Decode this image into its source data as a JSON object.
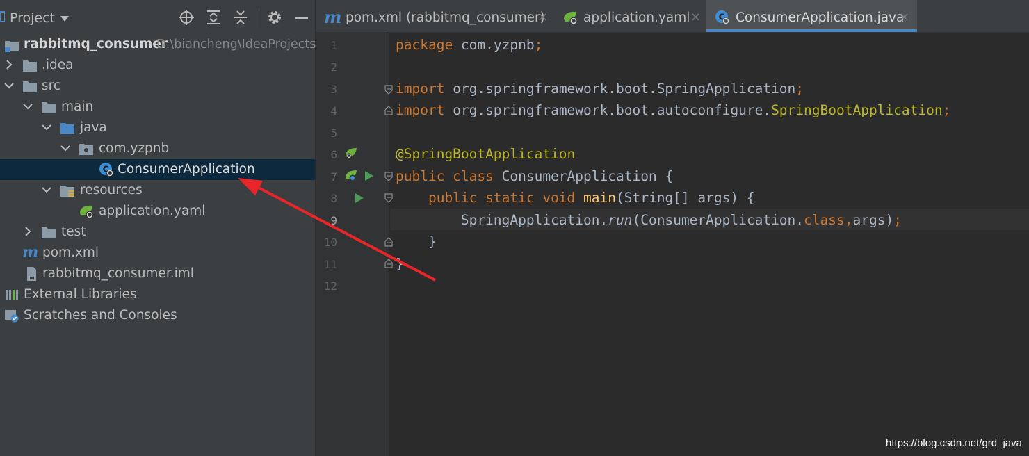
{
  "colors": {
    "accent": "#4a88c7",
    "annotation_arrow": "#e8262a",
    "keyword": "#cc7832",
    "annotation": "#bbb529",
    "method": "#ffc66d",
    "plain_code": "#a9b7c6"
  },
  "project_panel": {
    "title": "Project",
    "header_icons": [
      "dropdown-caret-icon",
      "locate-crosshair-icon",
      "expand-all-icon",
      "collapse-all-icon",
      "gear-icon",
      "minimize-icon"
    ],
    "tree": [
      {
        "label": "rabbitmq_consumer",
        "path": "D:\\biancheng\\IdeaProjects",
        "icon": "module-folder-icon",
        "bold": true
      },
      {
        "label": ".idea",
        "icon": "folder-icon",
        "expanded": false
      },
      {
        "label": "src",
        "icon": "folder-icon",
        "expanded": true
      },
      {
        "label": "main",
        "icon": "folder-icon",
        "expanded": true
      },
      {
        "label": "java",
        "icon": "source-folder-icon",
        "expanded": true
      },
      {
        "label": "com.yzpnb",
        "icon": "package-icon",
        "expanded": true
      },
      {
        "label": "ConsumerApplication",
        "icon": "spring-class-icon",
        "selected": true
      },
      {
        "label": "resources",
        "icon": "resources-folder-icon",
        "expanded": true
      },
      {
        "label": "application.yaml",
        "icon": "spring-yaml-icon"
      },
      {
        "label": "test",
        "icon": "folder-icon",
        "expanded": false
      },
      {
        "label": "pom.xml",
        "icon": "maven-icon"
      },
      {
        "label": "rabbitmq_consumer.iml",
        "icon": "iml-file-icon"
      },
      {
        "label": "External Libraries",
        "icon": "libraries-icon"
      },
      {
        "label": "Scratches and Consoles",
        "icon": "scratches-icon"
      }
    ]
  },
  "editor": {
    "tabs": [
      {
        "label": "pom.xml (rabbitmq_consumer)",
        "icon": "maven-icon",
        "active": false,
        "close": "×"
      },
      {
        "label": "application.yaml",
        "icon": "spring-yaml-icon",
        "active": false,
        "close": "×"
      },
      {
        "label": "ConsumerApplication.java",
        "icon": "spring-class-icon",
        "active": true,
        "close": "×"
      }
    ],
    "line_numbers": [
      "1",
      "2",
      "3",
      "4",
      "5",
      "6",
      "7",
      "8",
      "9",
      "10",
      "11",
      "12"
    ],
    "current_line": "9",
    "code": {
      "l1_kw": "package",
      "l1_rest": " com.yzpnb",
      "l1_semi": ";",
      "l3_kw": "import",
      "l3_rest": " org.springframework.boot.SpringApplication",
      "l3_semi": ";",
      "l4_kw": "import",
      "l4_rest": " org.springframework.boot.autoconfigure.",
      "l4_ann": "SpringBootApplication",
      "l4_semi": ";",
      "l6_ann": "@SpringBootApplication",
      "l7_kw": "public class",
      "l7_rest": " ConsumerApplication {",
      "l8_indent": "    ",
      "l8_kw": "public static void",
      "l8_sp": " ",
      "l8_fn": "main",
      "l8_rest": "(String[] args) {",
      "l9_indent": "        ",
      "l9_a": "SpringApplication.",
      "l9_run": "run",
      "l9_b": "(ConsumerApplication.",
      "l9_class": "class,",
      "l9_c": "args)",
      "l9_semi": ";",
      "l10": "    }",
      "l11": "}"
    },
    "gutter_icons": [
      "spring-bean-icon",
      "run-icon"
    ]
  },
  "watermark": "https://blog.csdn.net/grd_java"
}
